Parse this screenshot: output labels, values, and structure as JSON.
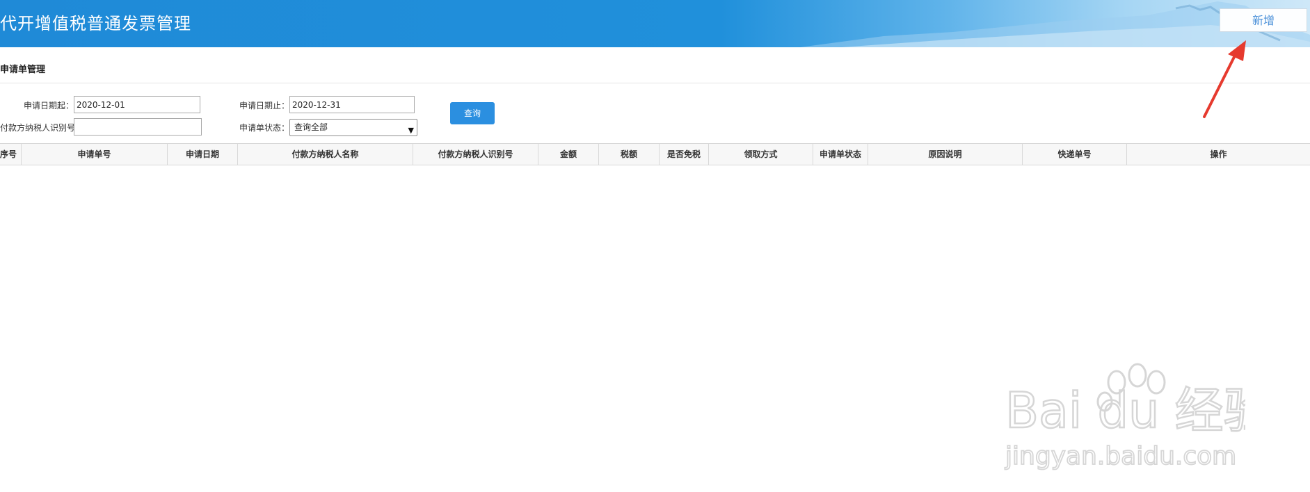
{
  "header": {
    "title": "代开增值税普通发票管理",
    "add_button": "新增"
  },
  "section": {
    "title": "申请单管理"
  },
  "form": {
    "start_date_label": "申请日期起：",
    "start_date_value": "2020-12-01",
    "end_date_label": "申请日期止：",
    "end_date_value": "2020-12-31",
    "payer_id_label": "付款方纳税人识别号：",
    "payer_id_value": "",
    "status_label": "申请单状态：",
    "status_value": "查询全部",
    "query_button": "查询"
  },
  "table": {
    "columns": [
      "序号",
      "申请单号",
      "申请日期",
      "付款方纳税人名称",
      "付款方纳税人识别号",
      "金额",
      "税额",
      "是否免税",
      "领取方式",
      "申请单状态",
      "原因说明",
      "快递单号",
      "操作"
    ],
    "rows": []
  },
  "watermark": {
    "brand": "Bai du 经验",
    "url": "jingyan.baidu.com"
  },
  "colors": {
    "header_blue": "#2090db",
    "button_blue": "#2b8fe0",
    "annotation_red": "#e63a2e"
  }
}
